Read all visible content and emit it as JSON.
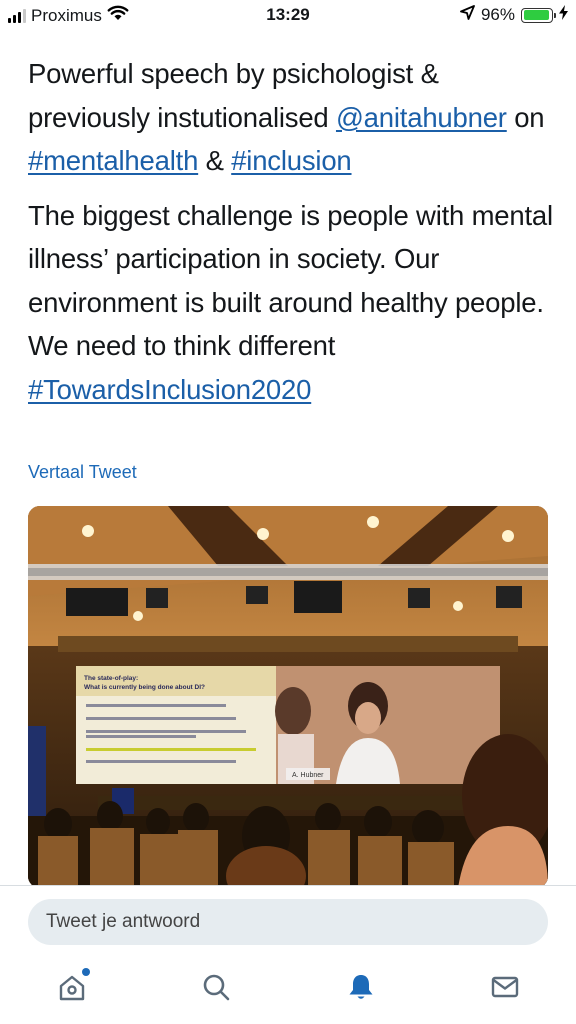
{
  "status_bar": {
    "carrier": "Proximus",
    "time": "13:29",
    "battery_percent": "96%",
    "battery_level": 0.96,
    "icons": [
      "signal-icon",
      "wifi-icon",
      "location-arrow-icon",
      "battery-icon",
      "charging-bolt-icon"
    ]
  },
  "tweet": {
    "p1_part1": "Powerful speech by psichologist & previously instutionalised ",
    "mention": "@anitahubner",
    "p1_part2": " on ",
    "hashtag1": "#mentalhealth",
    "p1_part3": " & ",
    "hashtag2": "#inclusion",
    "p2_text": "The biggest challenge is people with mental illness’ participation in society. Our environment is built around healthy people. We need to think different",
    "hashtag3": "#TowardsInclusion2020",
    "translate_label": "Vertaal Tweet"
  },
  "photo": {
    "slide_title_line1": "The state-of-play:",
    "slide_title_line2": "What is currently being done about DI?",
    "speaker_caption": "A. Hubner"
  },
  "reply": {
    "placeholder": "Tweet je antwoord"
  },
  "tab_bar": {
    "tabs": [
      "home-icon",
      "search-icon",
      "notifications-bell-icon",
      "messages-mail-icon"
    ],
    "active_tab": "notifications-bell-icon",
    "accent_color": "#1d6ab8"
  },
  "colors": {
    "link": "#1b5fa8",
    "accent": "#1d6ab8",
    "reply_bg": "#e6ecf0",
    "battery": "#2ecc40"
  }
}
